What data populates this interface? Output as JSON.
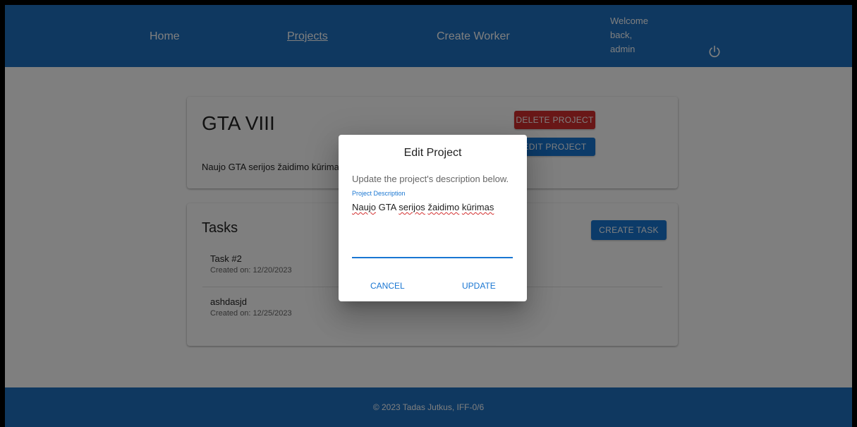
{
  "nav": {
    "home": "Home",
    "projects": "Projects",
    "create_worker": "Create Worker",
    "welcome_line1": "Welcome",
    "welcome_line2": "back,",
    "welcome_line3": "admin"
  },
  "project": {
    "title": "GTA VIII",
    "description": "Naujo GTA serijos žaidimo kūrimas",
    "delete_label": "DELETE PROJECT",
    "edit_label": "EDIT PROJECT"
  },
  "tasks": {
    "title": "Tasks",
    "create_label": "CREATE TASK",
    "items": [
      {
        "name": "Task #2",
        "created": "Created on: 12/20/2023"
      },
      {
        "name": "ashdasjd",
        "created": "Created on: 12/25/2023"
      }
    ]
  },
  "dialog": {
    "title": "Edit Project",
    "text": "Update the project's description below.",
    "field_label": "Project Description",
    "field_words": [
      "Naujo",
      " GTA ",
      "serijos",
      " ",
      "žaidimo",
      " ",
      "kūrimas"
    ],
    "cancel_label": "CANCEL",
    "update_label": "UPDATE"
  },
  "footer": {
    "text": "© 2023 Tadas Jutkus, IFF-0/6"
  },
  "colors": {
    "primary": "#1976d2",
    "navbar": "#1e70c0",
    "danger": "#d32f2f"
  },
  "icons": {
    "power": "power-icon"
  }
}
